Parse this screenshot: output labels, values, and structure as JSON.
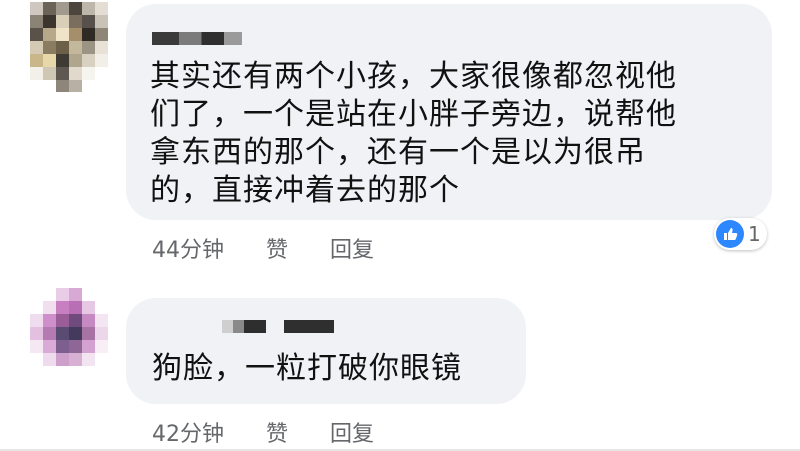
{
  "comments": [
    {
      "text": "其实还有两个小孩，大家很像都忽视他\n们了，一个是站在小胖子旁边，说帮他\n拿东西的那个，还有一个是以为很吊\n的，直接冲着去的那个",
      "time": "44分钟",
      "like_label": "赞",
      "reply_label": "回复",
      "reaction_count": "1",
      "reaction_icon": "like-icon"
    },
    {
      "text": "狗脸，一粒打破你眼镜",
      "time": "42分钟",
      "like_label": "赞",
      "reply_label": "回复"
    }
  ],
  "colors": {
    "bubble": "#f0f2f5",
    "meta_text": "#65676b",
    "like_blue": "#2d88ff"
  }
}
